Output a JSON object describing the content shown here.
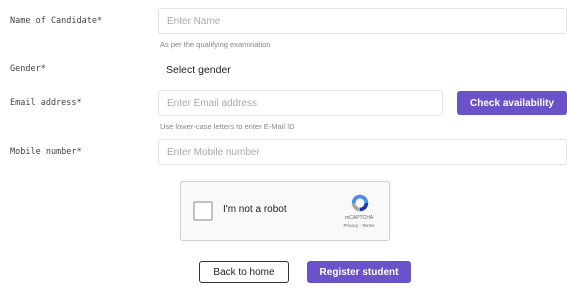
{
  "form": {
    "name": {
      "label": "Name of Candidate*",
      "placeholder": "Enter Name",
      "hint": "As per the qualifying examination"
    },
    "gender": {
      "label": "Gender*",
      "selected": "Select gender"
    },
    "email": {
      "label": "Email address*",
      "placeholder": "Enter Email address",
      "hint": "Use lower-case letters to enter E-Mail ID",
      "check_label": "Check availability"
    },
    "mobile": {
      "label": "Mobile number*",
      "placeholder": "Enter Mobile number"
    }
  },
  "captcha": {
    "label": "I'm not a robot",
    "brand": "reCAPTCHA",
    "links": "Privacy - Terms",
    "logo_icon": "recaptcha-logo-icon"
  },
  "actions": {
    "back_label": "Back to home",
    "register_label": "Register student"
  },
  "colors": {
    "accent": "#6b52c9"
  }
}
